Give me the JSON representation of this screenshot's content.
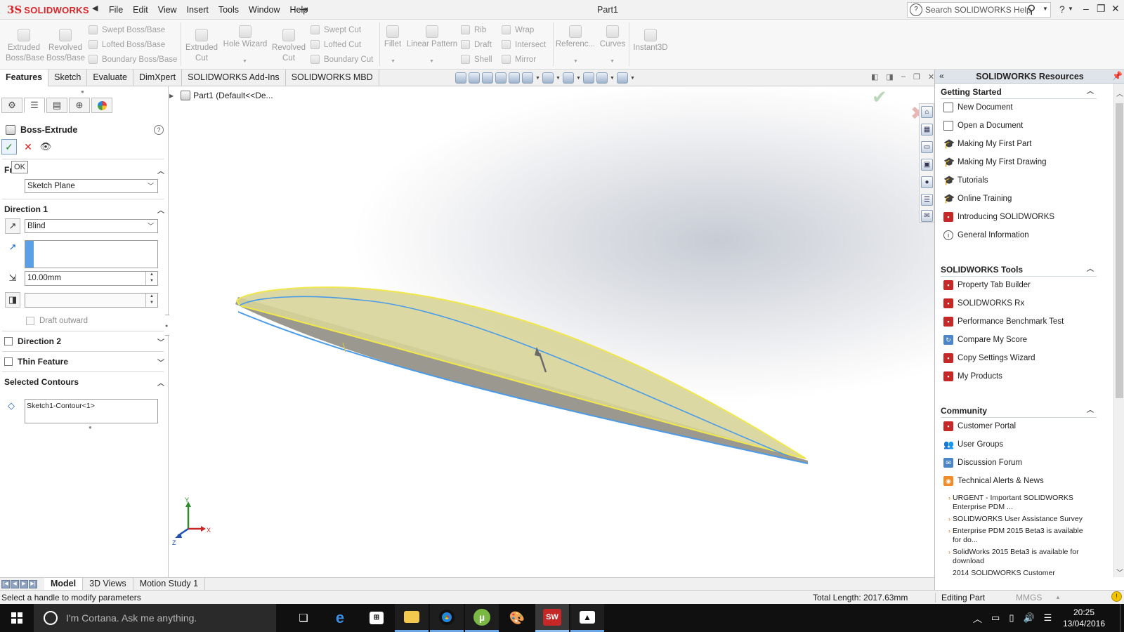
{
  "app": {
    "logo_mark": "3S",
    "logo_text": "SOLIDWORKS",
    "document_title": "Part1"
  },
  "menu": [
    "File",
    "Edit",
    "View",
    "Insert",
    "Tools",
    "Window",
    "Help"
  ],
  "help_search": {
    "placeholder": "Search SOLIDWORKS Help"
  },
  "ribbon": {
    "extruded_boss": [
      "Extruded",
      "Boss/Base"
    ],
    "revolved_boss": [
      "Revolved",
      "Boss/Base"
    ],
    "swept_boss": "Swept Boss/Base",
    "lofted_boss": "Lofted Boss/Base",
    "boundary_boss": "Boundary Boss/Base",
    "extruded_cut": [
      "Extruded",
      "Cut"
    ],
    "hole_wizard": "Hole Wizard",
    "revolved_cut": [
      "Revolved",
      "Cut"
    ],
    "swept_cut": "Swept Cut",
    "lofted_cut": "Lofted Cut",
    "boundary_cut": "Boundary Cut",
    "fillet": "Fillet",
    "linear_pattern": "Linear Pattern",
    "rib": "Rib",
    "draft": "Draft",
    "shell": "Shell",
    "wrap": "Wrap",
    "intersect": "Intersect",
    "mirror": "Mirror",
    "reference": "Referenc...",
    "curves": "Curves",
    "instant3d": "Instant3D"
  },
  "cm_tabs": [
    {
      "label": "Features",
      "active": true
    },
    {
      "label": "Sketch",
      "active": false
    },
    {
      "label": "Evaluate",
      "active": false
    },
    {
      "label": "DimXpert",
      "active": false
    },
    {
      "label": "SOLIDWORKS Add-Ins",
      "active": false
    },
    {
      "label": "SOLIDWORKS MBD",
      "active": false
    }
  ],
  "property_manager": {
    "title": "Boss-Extrude",
    "ok_tooltip": "OK",
    "from_label": "Fr",
    "from_value": "Sketch Plane",
    "direction1": {
      "label": "Direction 1",
      "end_condition": "Blind",
      "depth": "10.00mm",
      "draft_outward": "Draft outward"
    },
    "direction2": {
      "label": "Direction 2"
    },
    "thin_feature": {
      "label": "Thin Feature"
    },
    "selected_contours": {
      "label": "Selected Contours",
      "value": "Sketch1-Contour<1>"
    }
  },
  "graphics": {
    "tree_part": "Part1",
    "tree_config": "(Default<<De...",
    "triad": {
      "x": "X",
      "y": "Y",
      "z": "Z"
    }
  },
  "bottom_tabs": [
    {
      "label": "Model",
      "active": true
    },
    {
      "label": "3D Views",
      "active": false
    },
    {
      "label": "Motion Study 1",
      "active": false
    }
  ],
  "task_pane": {
    "title": "SOLIDWORKS Resources",
    "getting_started": {
      "label": "Getting Started",
      "items": [
        "New Document",
        "Open a Document",
        "Making My First Part",
        "Making My First Drawing",
        "Tutorials",
        "Online Training",
        "Introducing SOLIDWORKS",
        "General Information"
      ]
    },
    "tools": {
      "label": "SOLIDWORKS Tools",
      "items": [
        "Property Tab Builder",
        "SOLIDWORKS Rx",
        "Performance Benchmark Test",
        "Compare My Score",
        "Copy Settings Wizard",
        "My Products"
      ]
    },
    "community": {
      "label": "Community",
      "items": [
        "Customer Portal",
        "User Groups",
        "Discussion Forum",
        "Technical Alerts & News"
      ]
    },
    "news": [
      "URGENT - Important SOLIDWORKS Enterprise PDM ...",
      "SOLIDWORKS User Assistance Survey",
      "Enterprise PDM 2015 Beta3 is available for do...",
      "SolidWorks 2015 Beta3 is available for download",
      "2014 SOLIDWORKS Customer"
    ]
  },
  "status": {
    "message": "Select a handle to modify parameters",
    "total_length": "Total Length: 2017.63mm",
    "mode": "Editing Part",
    "units": "MMGS"
  },
  "taskbar": {
    "cortana_placeholder": "I'm Cortana. Ask me anything.",
    "time": "20:25",
    "date": "13/04/2016"
  },
  "colors": {
    "accent_red": "#d7262a",
    "airfoil_fill": "#d8d499",
    "airfoil_edge": "#f0e84a",
    "sketch_blue": "#4a9be8"
  }
}
